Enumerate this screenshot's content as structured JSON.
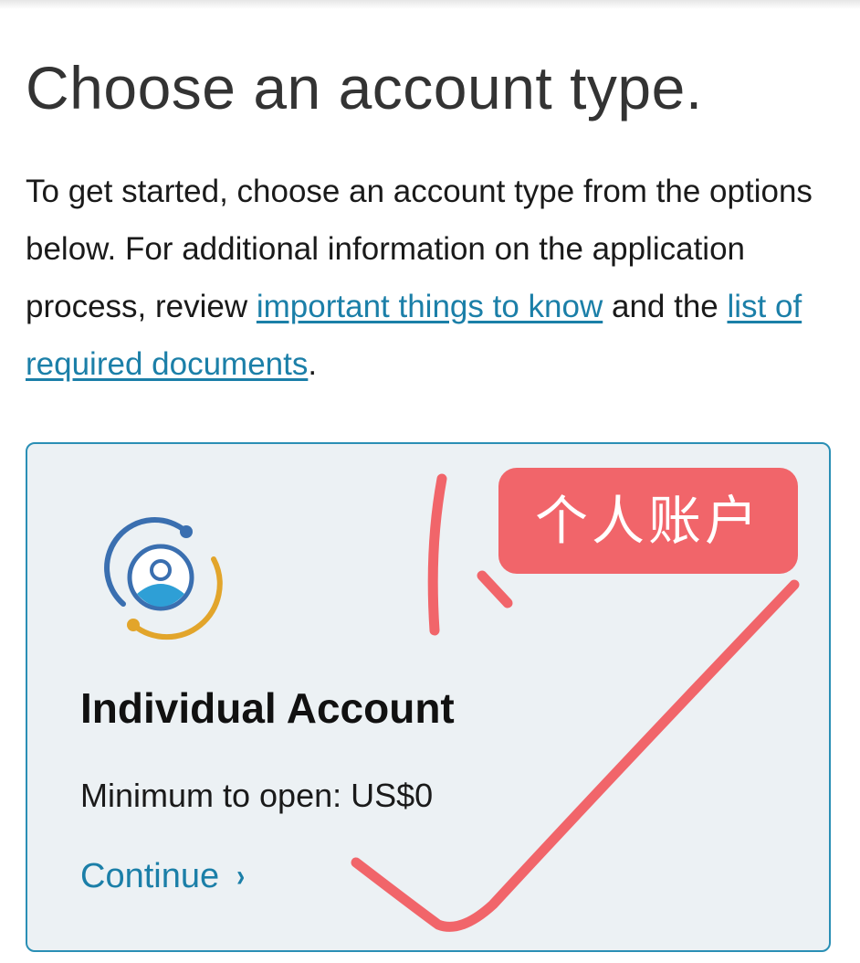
{
  "page": {
    "title": "Choose an account type.",
    "intro": {
      "text_before": "To get started, choose an account type from the options below. For additional information on the application process, review ",
      "link1": "important things to know",
      "text_middle": " and the ",
      "link2": "list of required documents",
      "text_after": "."
    }
  },
  "card": {
    "icon": "individual-person-icon",
    "title": "Individual Account",
    "minimum": "Minimum to open: US$0",
    "continue_label": "Continue",
    "continue_icon": "chevron-right-icon"
  },
  "annotation": {
    "label": "个人账户",
    "color": "#f1656a"
  },
  "colors": {
    "link": "#1b7fa8",
    "card_border": "#2a8fb5",
    "card_bg": "#ecf1f4",
    "icon_blue": "#3a6fb0",
    "icon_gold": "#e2a52b",
    "icon_light_blue": "#2e9fd6"
  }
}
